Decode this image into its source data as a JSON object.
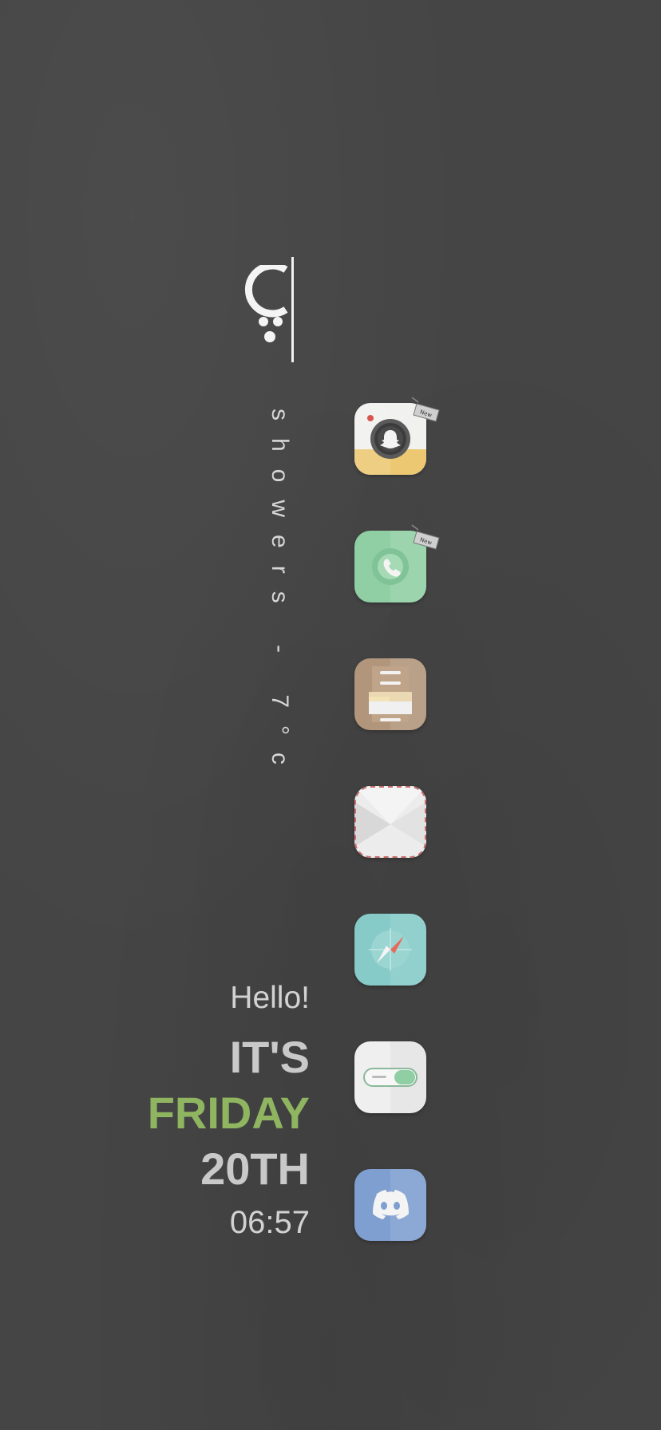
{
  "weather": {
    "icon": "showers-icon",
    "text": "showers - 7°c"
  },
  "greeting": {
    "hello": "Hello!",
    "its": "IT'S",
    "day": "FRIDAY",
    "date": "20TH",
    "time": "06:57"
  },
  "colors": {
    "background": "#454545",
    "accent_green": "#8fb561",
    "text_light": "#d2d2d2"
  },
  "dock": {
    "apps": [
      {
        "icon": "snapchat-camera-icon",
        "badge": "new-tag-icon"
      },
      {
        "icon": "phone-icon",
        "badge": "new-tag-icon"
      },
      {
        "icon": "files-cabinet-icon"
      },
      {
        "icon": "mail-envelope-icon"
      },
      {
        "icon": "safari-compass-icon"
      },
      {
        "icon": "settings-toggle-icon"
      },
      {
        "icon": "discord-icon"
      }
    ]
  }
}
